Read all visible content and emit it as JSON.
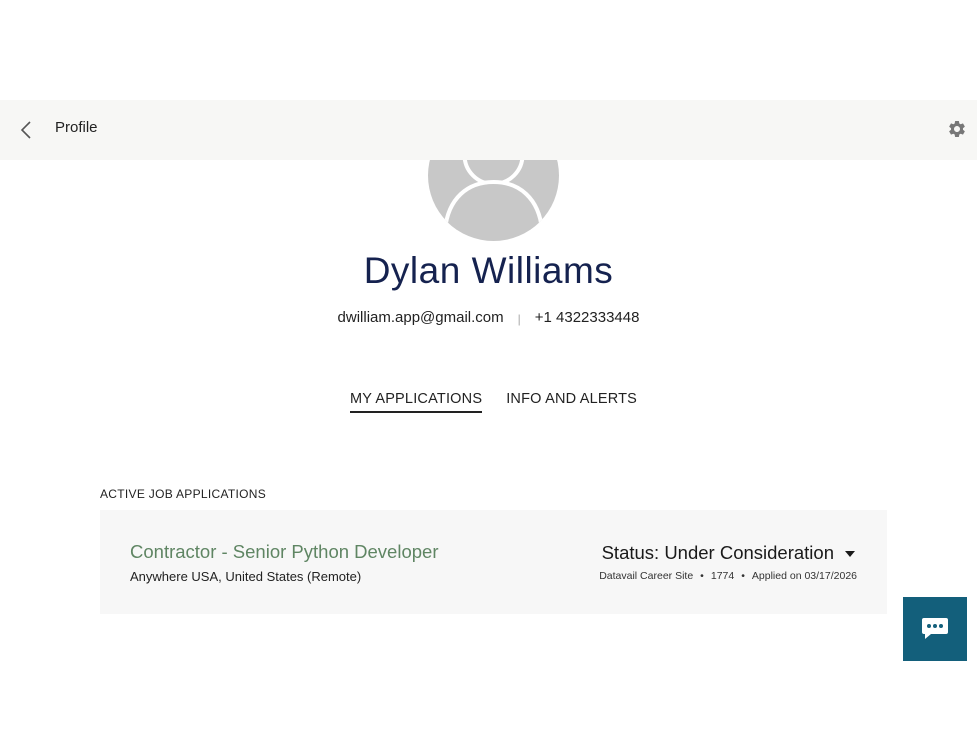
{
  "header": {
    "title": "Profile",
    "back_icon": "chevron-left-icon",
    "settings_icon": "gear-icon"
  },
  "profile": {
    "avatar_icon": "user-avatar-icon",
    "name": "Dylan Williams",
    "email": "dwilliam.app@gmail.com",
    "separator": "|",
    "phone": "+1 4322333448"
  },
  "tabs": [
    {
      "label": "MY APPLICATIONS",
      "active": true
    },
    {
      "label": "INFO AND ALERTS",
      "active": false
    }
  ],
  "applications": {
    "section_label": "ACTIVE JOB APPLICATIONS",
    "items": [
      {
        "title": "Contractor - Senior Python Developer",
        "location": "Anywhere USA, United States (Remote)",
        "status": "Status: Under Consideration",
        "source": "Datavail Career Site",
        "job_id": "1774",
        "applied": "Applied on 03/17/2026",
        "meta_separator": "•"
      }
    ]
  },
  "chat": {
    "icon": "chat-bubble-icon"
  },
  "colors": {
    "name": "#15224f",
    "job_title": "#5f8563",
    "chat_button": "#135f7b",
    "header_bg": "#f7f7f5",
    "card_bg": "#f7f7f7"
  }
}
